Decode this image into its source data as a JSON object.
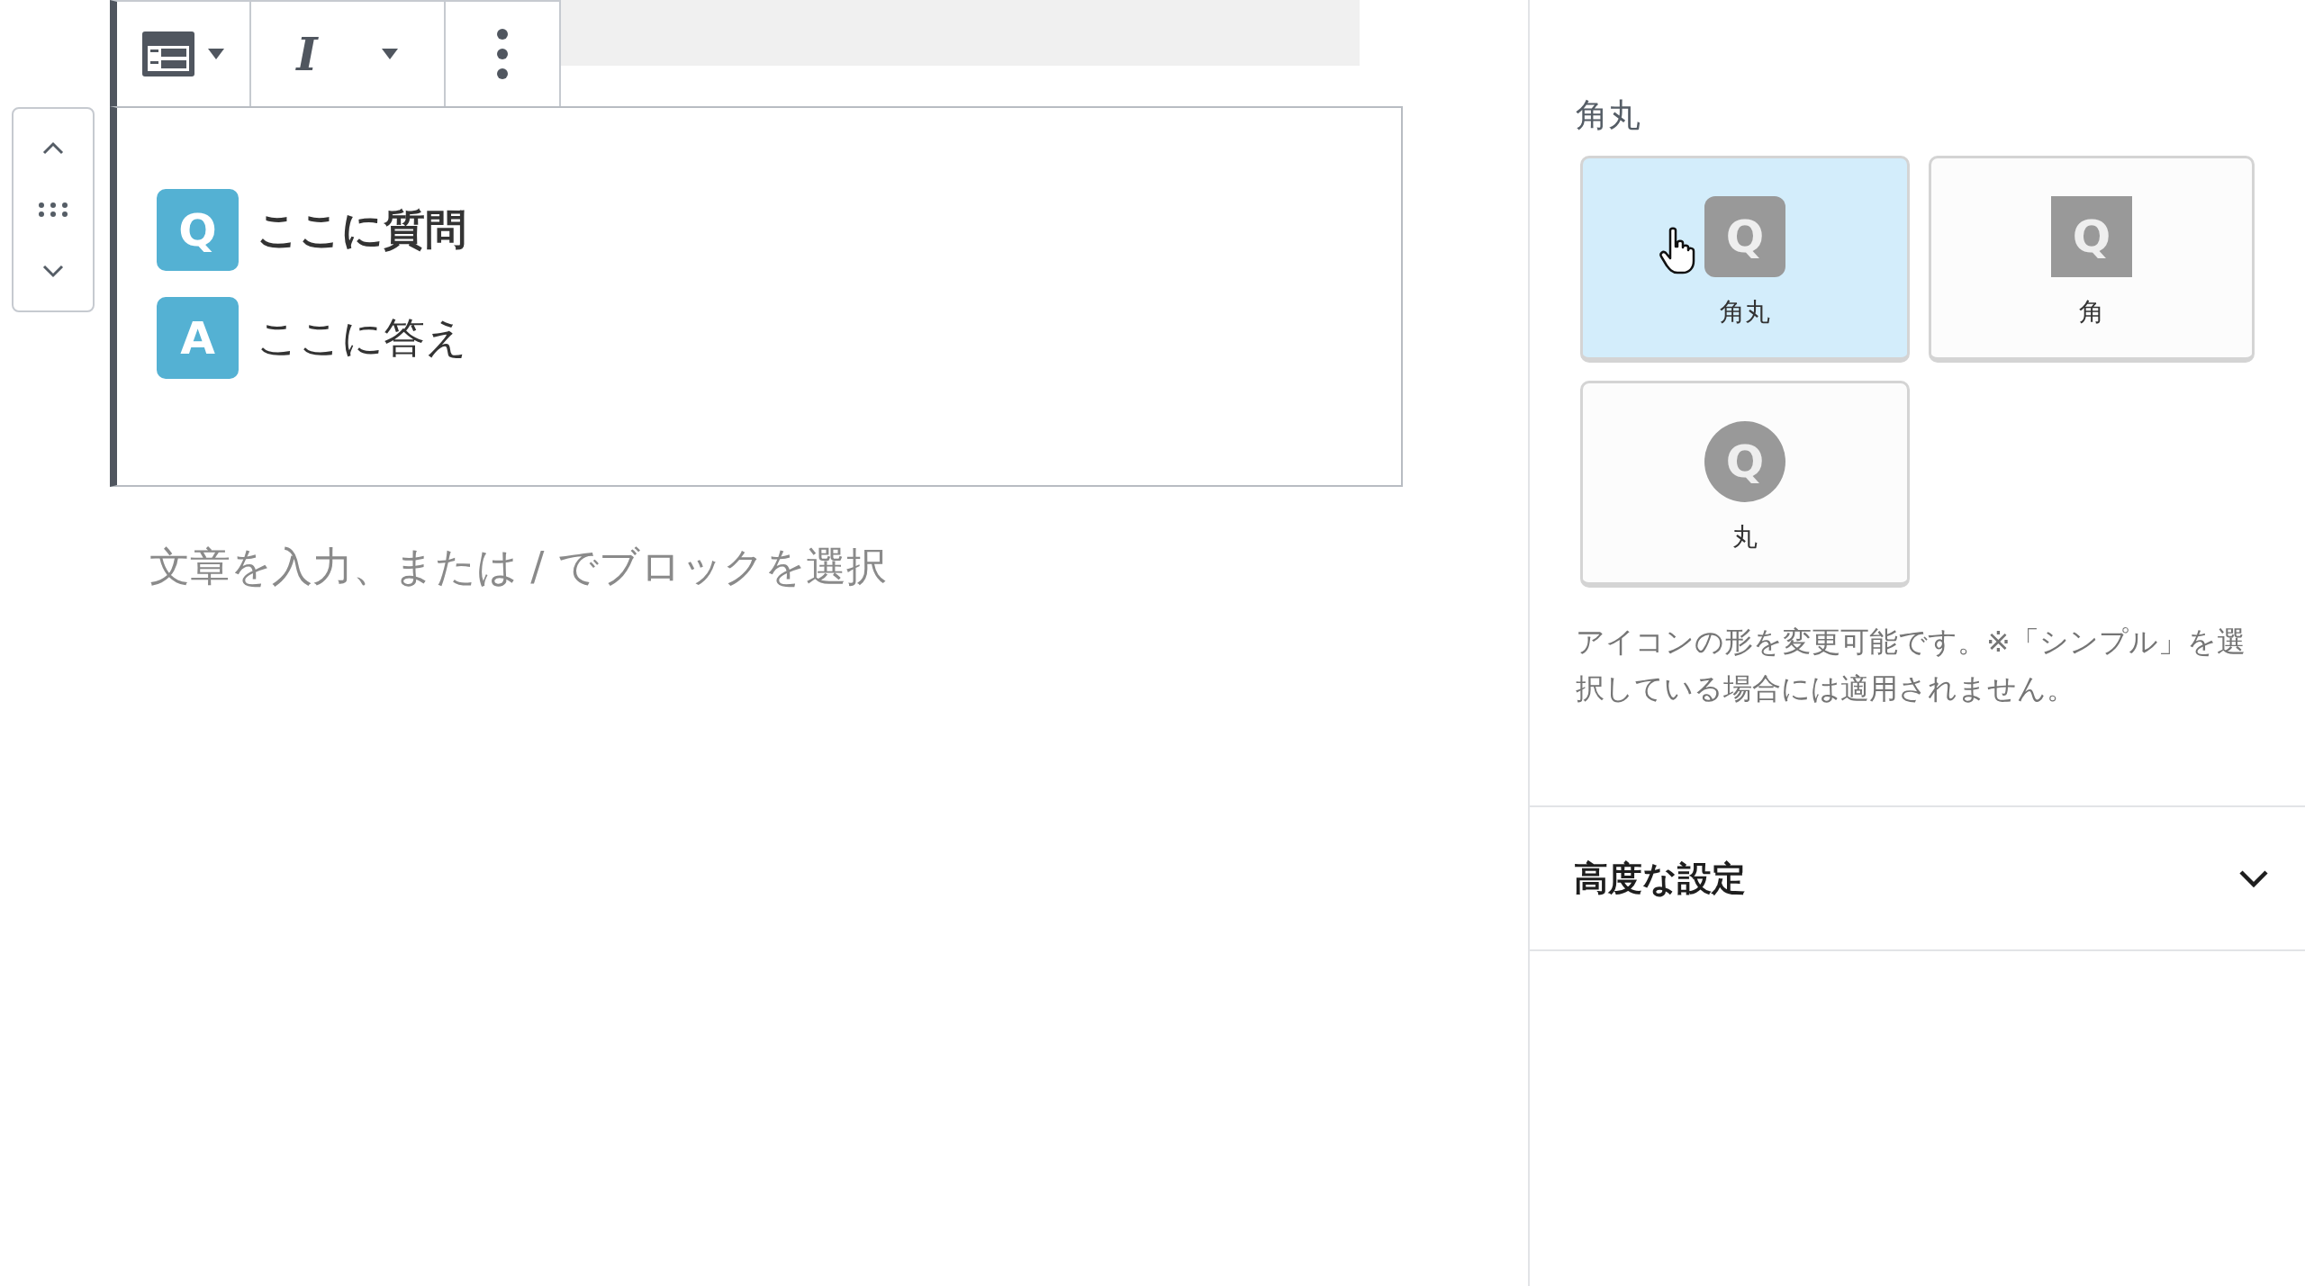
{
  "toolbar": {
    "italic_label": "I"
  },
  "qa_block": {
    "rows": [
      {
        "kind": "question",
        "badge": "Q",
        "text": "ここに質問"
      },
      {
        "kind": "answer",
        "badge": "A",
        "text": "ここに答え"
      }
    ]
  },
  "paragraph": {
    "placeholder": "文章を入力、または / でブロックを選択"
  },
  "sidebar": {
    "section_label": "角丸",
    "options": [
      {
        "kind": "rounded",
        "badge": "Q",
        "label": "角丸",
        "selected": true
      },
      {
        "kind": "square",
        "badge": "Q",
        "label": "角",
        "selected": false
      },
      {
        "kind": "circle",
        "badge": "Q",
        "label": "丸",
        "selected": false
      }
    ],
    "help": "アイコンの形を変更可能です。※「シンプル」を選択している場合には適用されません。",
    "advanced": {
      "title": "高度な設定",
      "expanded": false
    }
  }
}
